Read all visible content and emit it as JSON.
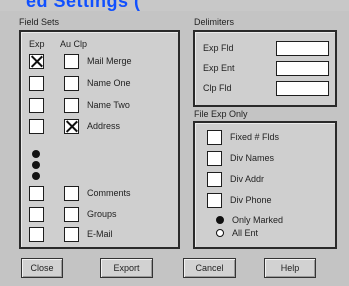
{
  "header_fragment": "ed Settings (",
  "field_sets": {
    "title": "Field Sets",
    "col_exp": "Exp",
    "col_au_clp": "Au Clp",
    "rows": [
      {
        "label": "Mail Merge",
        "exp_checked": true,
        "au_clp_checked": false
      },
      {
        "label": "Name One",
        "exp_checked": false,
        "au_clp_checked": false
      },
      {
        "label": "Name Two",
        "exp_checked": false,
        "au_clp_checked": false
      },
      {
        "label": "Address",
        "exp_checked": false,
        "au_clp_checked": true
      },
      {
        "label": "Comments",
        "exp_checked": false,
        "au_clp_checked": false
      },
      {
        "label": "Groups",
        "exp_checked": false,
        "au_clp_checked": false
      },
      {
        "label": "E-Mail",
        "exp_checked": false,
        "au_clp_checked": false
      }
    ]
  },
  "delimiters": {
    "title": "Delimiters",
    "fields": [
      {
        "label": "Exp Fld",
        "value": ""
      },
      {
        "label": "Exp Ent",
        "value": ""
      },
      {
        "label": "Clp Fld",
        "value": ""
      }
    ]
  },
  "file_exp_only": {
    "title": "File Exp Only",
    "options": [
      {
        "label": "Fixed # Flds",
        "checked": false
      },
      {
        "label": "Div Names",
        "checked": false
      },
      {
        "label": "Div Addr",
        "checked": false
      },
      {
        "label": "Div Phone",
        "checked": false
      }
    ],
    "radios": [
      {
        "label": "Only Marked",
        "selected": true
      },
      {
        "label": "All Ent",
        "selected": false
      }
    ]
  },
  "buttons": {
    "close": "Close",
    "export": "Export",
    "cancel": "Cancel",
    "help": "Help"
  }
}
